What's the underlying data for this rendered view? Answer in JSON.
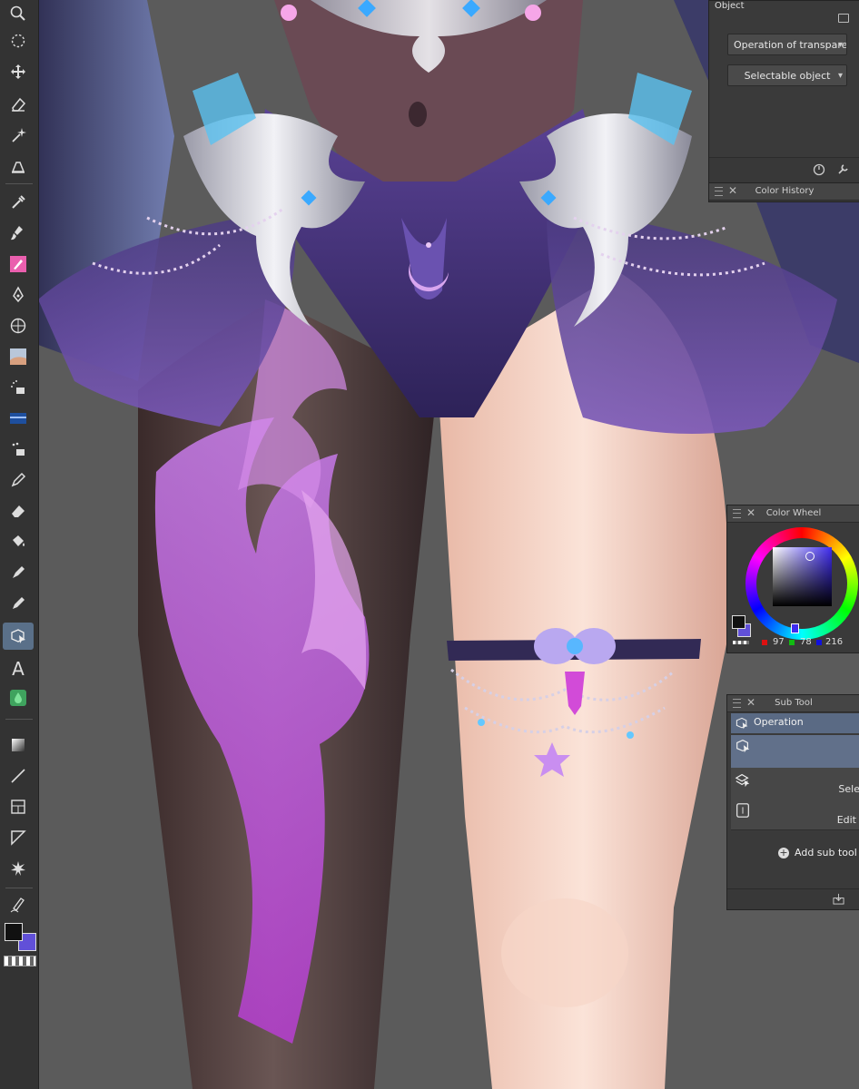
{
  "toolbar": {
    "tools": [
      "zoom-icon",
      "lasso-icon",
      "move-icon",
      "eraser-icon",
      "magic-wand-icon",
      "fill-icon",
      "eyedropper-icon",
      "brush-icon",
      "pen-icon",
      "pen-tool-icon",
      "grid-icon",
      "image-icon",
      "airbrush-icon",
      "pattern-icon",
      "decoration-icon",
      "pencil-icon",
      "eraser-2-icon",
      "bucket-icon",
      "marker-icon",
      "pen-2-icon",
      "object-select-icon",
      "text-icon",
      "droplet-icon",
      "gradient-icon",
      "line-icon",
      "frame-icon",
      "ruler-icon",
      "burst-icon",
      "correction-icon"
    ],
    "active_tool": "object-select-icon",
    "text_tool_glyph": "A",
    "main_color": "#111111",
    "sub_color": "#6150d8"
  },
  "object_panel": {
    "title": "Object",
    "transparent_dropdown": "Operation of transparent part",
    "selectable_dropdown": "Selectable object"
  },
  "color_history_panel": {
    "title": "Color History"
  },
  "color_wheel_panel": {
    "title": "Color Wheel",
    "r": "97",
    "g": "78",
    "b": "216",
    "hue_color": "#3f2cf0"
  },
  "sub_tool_panel": {
    "title": "Sub Tool",
    "group_label": "Operation",
    "items": [
      {
        "label": "",
        "icon": "object-select-icon"
      },
      {
        "label": "Sele",
        "icon": "layer-select-icon"
      },
      {
        "label": "Edit",
        "icon": "edit-icon"
      }
    ],
    "add_label": "Add sub tool"
  }
}
